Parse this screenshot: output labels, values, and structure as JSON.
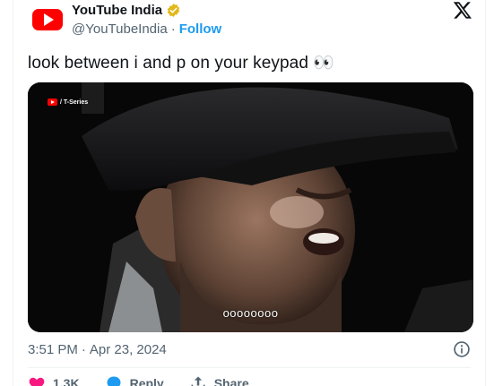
{
  "author": {
    "display_name": "YouTube India",
    "handle": "@YouTubeIndia",
    "separator": "·",
    "follow_label": "Follow",
    "avatar_icon": "youtube-logo-icon",
    "verified_icon": "verified-gold-badge-icon",
    "verified_color": "#e2b719"
  },
  "platform_icon": "x-logo-icon",
  "tweet": {
    "text": "look between i and p on your keypad 👀"
  },
  "media": {
    "watermark": "/ T-Series",
    "subtitle": "oooooooo"
  },
  "meta": {
    "time": "3:51 PM",
    "separator": "·",
    "date": "Apr 23, 2024",
    "info_icon": "info-circle-icon"
  },
  "actions": [
    {
      "icon": "heart-icon",
      "label": "1.3K",
      "color": "#f91880"
    },
    {
      "icon": "reply-bubble-icon",
      "label": "Reply",
      "color": "#1d9bf0"
    },
    {
      "icon": "share-icon",
      "label": "Share",
      "color": "#536471"
    }
  ],
  "colors": {
    "accent": "#1d9bf0",
    "text_primary": "#0f1419",
    "text_secondary": "#536471",
    "youtube_red": "#ff0000"
  }
}
